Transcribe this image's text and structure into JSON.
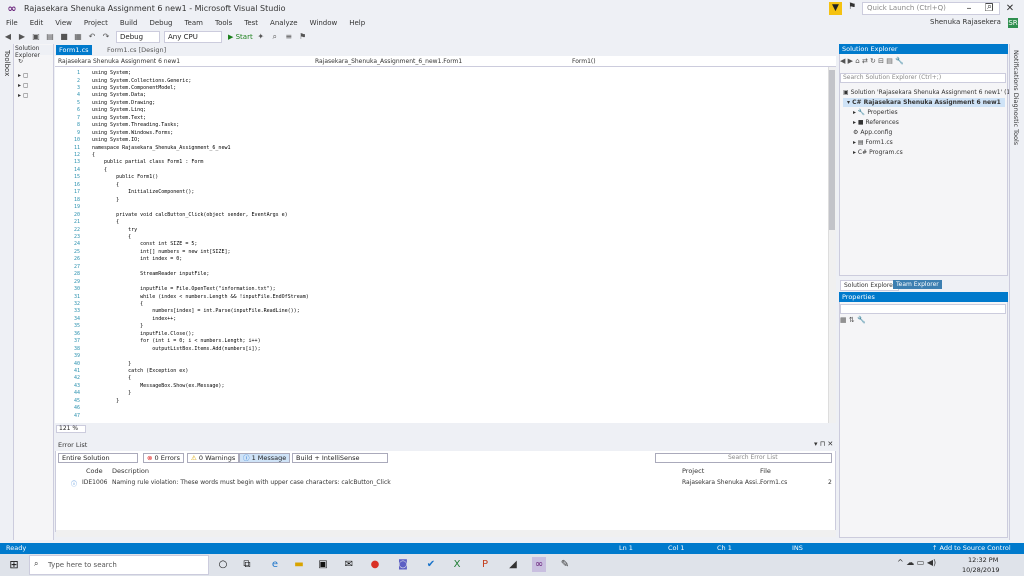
{
  "window": {
    "title": "Rajasekara Shenuka Assignment 6 new1 - Microsoft Visual Studio",
    "quick_launch_placeholder": "Quick Launch (Ctrl+Q)",
    "user": "Shenuka Rajasekera",
    "user_initial": "SR"
  },
  "menu": [
    "File",
    "Edit",
    "View",
    "Project",
    "Build",
    "Debug",
    "Team",
    "Tools",
    "Test",
    "Analyze",
    "Window",
    "Help"
  ],
  "toolbar": {
    "config": "Debug",
    "platform": "Any CPU",
    "start": "Start"
  },
  "left_strip": {
    "label": "Toolbox"
  },
  "left_panel": {
    "title": "Solution Explorer"
  },
  "editor": {
    "tab_active": "Form1.cs",
    "tab_design": "Form1.cs [Design]",
    "nav_project": "Rajasekara Shenuka Assignment 6 new1",
    "nav_class": "Rajasekara_Shenuka_Assignment_6_new1.Form1",
    "nav_member": "Form1()",
    "zoom": "121 %",
    "lines": [
      {
        "n": "1",
        "t": "using System;"
      },
      {
        "n": "2",
        "t": "using System.Collections.Generic;"
      },
      {
        "n": "3",
        "t": "using System.ComponentModel;"
      },
      {
        "n": "4",
        "t": "using System.Data;"
      },
      {
        "n": "5",
        "t": "using System.Drawing;"
      },
      {
        "n": "6",
        "t": "using System.Linq;"
      },
      {
        "n": "7",
        "t": "using System.Text;"
      },
      {
        "n": "8",
        "t": "using System.Threading.Tasks;"
      },
      {
        "n": "9",
        "t": "using System.Windows.Forms;"
      },
      {
        "n": "10",
        "t": "using System.IO;"
      },
      {
        "n": "11",
        "t": "namespace Rajasekara_Shenuka_Assignment_6_new1"
      },
      {
        "n": "12",
        "t": "{"
      },
      {
        "n": "13",
        "t": "    public partial class Form1 : Form"
      },
      {
        "n": "14",
        "t": "    {"
      },
      {
        "n": "15",
        "t": "        public Form1()"
      },
      {
        "n": "16",
        "t": "        {"
      },
      {
        "n": "17",
        "t": "            InitializeComponent();"
      },
      {
        "n": "18",
        "t": "        }"
      },
      {
        "n": "19",
        "t": ""
      },
      {
        "n": "20",
        "t": "        private void calcButton_Click(object sender, EventArgs e)"
      },
      {
        "n": "21",
        "t": "        {"
      },
      {
        "n": "22",
        "t": "            try"
      },
      {
        "n": "23",
        "t": "            {"
      },
      {
        "n": "24",
        "t": "                const int SIZE = 5;"
      },
      {
        "n": "25",
        "t": "                int[] numbers = new int[SIZE];"
      },
      {
        "n": "26",
        "t": "                int index = 0;"
      },
      {
        "n": "27",
        "t": ""
      },
      {
        "n": "28",
        "t": "                StreamReader inputFile;"
      },
      {
        "n": "29",
        "t": ""
      },
      {
        "n": "30",
        "t": "                inputFile = File.OpenText(\"information.txt\");"
      },
      {
        "n": "31",
        "t": "                while (index < numbers.Length && !inputFile.EndOfStream)"
      },
      {
        "n": "32",
        "t": "                {"
      },
      {
        "n": "33",
        "t": "                    numbers[index] = int.Parse(inputFile.ReadLine());"
      },
      {
        "n": "34",
        "t": "                    index++;"
      },
      {
        "n": "35",
        "t": "                }"
      },
      {
        "n": "36",
        "t": "                inputFile.Close();"
      },
      {
        "n": "37",
        "t": "                for (int i = 0; i < numbers.Length; i++)"
      },
      {
        "n": "38",
        "t": "                    outputListBox.Items.Add(numbers[i]);"
      },
      {
        "n": "39",
        "t": ""
      },
      {
        "n": "40",
        "t": "            }"
      },
      {
        "n": "41",
        "t": "            catch (Exception ex)"
      },
      {
        "n": "42",
        "t": "            {"
      },
      {
        "n": "43",
        "t": "                MessageBox.Show(ex.Message);"
      },
      {
        "n": "44",
        "t": "            }"
      },
      {
        "n": "45",
        "t": "        }"
      },
      {
        "n": "46",
        "t": ""
      },
      {
        "n": "47",
        "t": ""
      }
    ]
  },
  "error_list": {
    "title": "Error List",
    "scope": "Entire Solution",
    "errors": "0 Errors",
    "warnings": "0 Warnings",
    "messages": "1 Message",
    "build_filter": "Build + IntelliSense",
    "search_placeholder": "Search Error List",
    "headers": {
      "code": "Code",
      "description": "Description",
      "project": "Project",
      "file": "File"
    },
    "row": {
      "code": "IDE1006",
      "description": "Naming rule violation: These words must begin with upper case characters: calcButton_Click",
      "project": "Rajasekara Shenuka Assi...",
      "file": "Form1.cs",
      "line": "2"
    }
  },
  "solution_explorer": {
    "title": "Solution Explorer",
    "search_placeholder": "Search Solution Explorer (Ctrl+;)",
    "items": [
      "Solution 'Rajasekara Shenuka Assignment 6 new1' (1",
      "Rajasekara Shenuka Assignment 6 new1",
      "Properties",
      "References",
      "App.config",
      "Form1.cs",
      "Program.cs"
    ],
    "tab1": "Solution Explorer",
    "tab2": "Team Explorer"
  },
  "properties": {
    "title": "Properties"
  },
  "right_strip": {
    "label": "Notifications   Diagnostic Tools"
  },
  "status": {
    "ready": "Ready",
    "ln": "Ln 1",
    "col": "Col 1",
    "ch": "Ch 1",
    "ins": "INS",
    "source_control": "Add to Source Control"
  },
  "taskbar": {
    "search_placeholder": "Type here to search",
    "time": "12:32 PM",
    "date": "10/28/2019"
  }
}
